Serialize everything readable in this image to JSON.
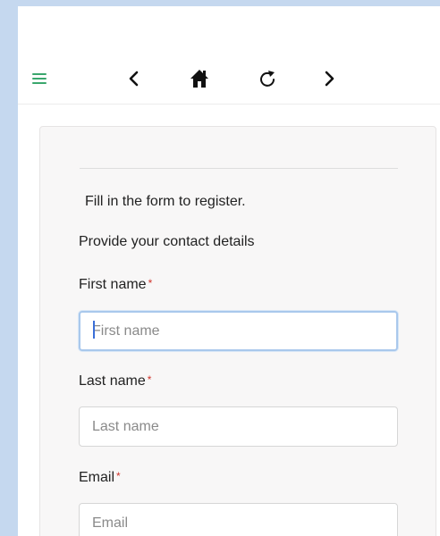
{
  "nav": {
    "menu_icon": "hamburger-menu-icon",
    "back_icon": "chevron-left-icon",
    "home_icon": "home-icon",
    "reload_icon": "reload-icon",
    "forward_icon": "chevron-right-icon",
    "back_glyph": "<",
    "forward_glyph": ">"
  },
  "form": {
    "intro": "Fill in the form to register.",
    "section_title": "Provide your contact details",
    "required_marker": "*",
    "fields": [
      {
        "label": "First name",
        "placeholder": "First name",
        "value": "",
        "focused": true
      },
      {
        "label": "Last name",
        "placeholder": "Last name",
        "value": ""
      },
      {
        "label": "Email",
        "placeholder": "Email",
        "value": ""
      }
    ]
  },
  "colors": {
    "frame": "#c5d8ef",
    "accent_menu": "#3aa76d",
    "required": "#d0342c",
    "focus_border": "#a9c8ec",
    "card_bg": "#f8f7f7"
  }
}
